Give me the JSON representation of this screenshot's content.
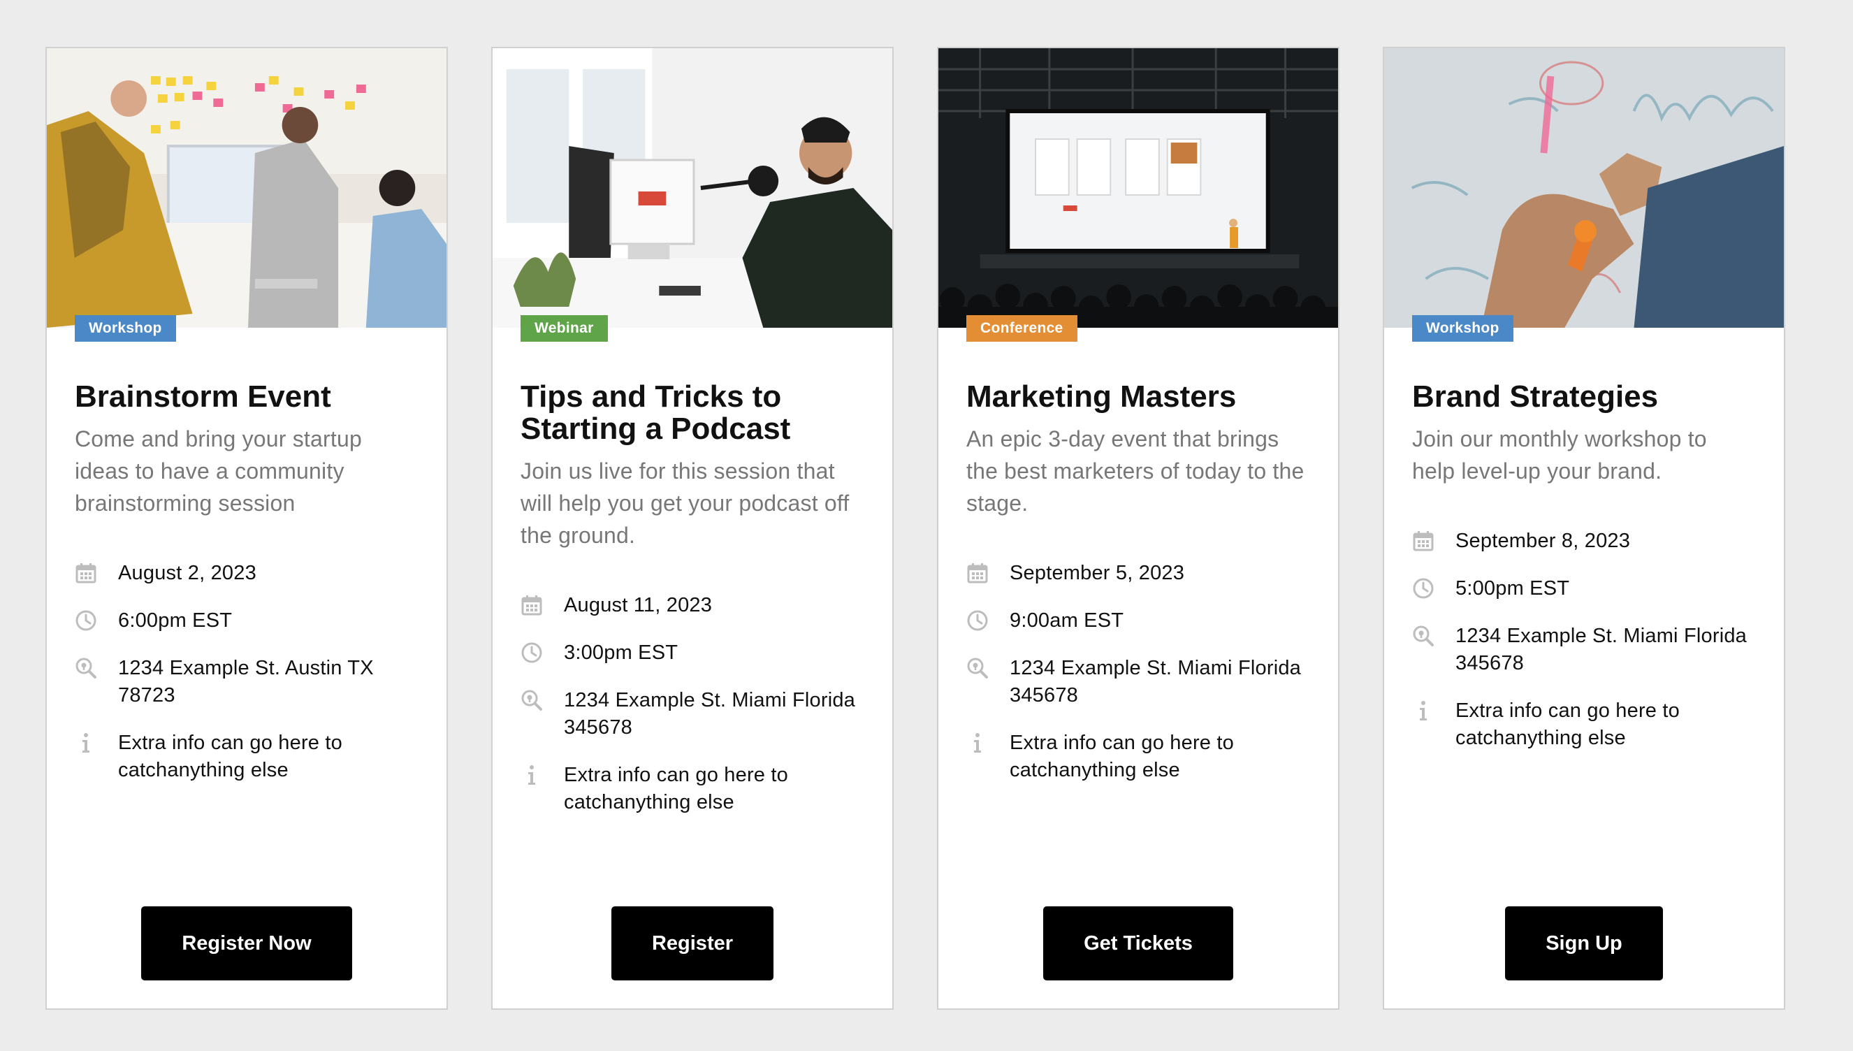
{
  "colors": {
    "workshop": "#4a88c8",
    "webinar": "#60a44a",
    "conference": "#e38e35",
    "button": "#000000",
    "icon": "#bdbdbd"
  },
  "cards": [
    {
      "badge": "Workshop",
      "badge_color": "#4a88c8",
      "title": "Brainstorm Event",
      "description": "Come and bring your startup ideas to have a community brainstorming session",
      "date": "August 2, 2023",
      "time": "6:00pm EST",
      "location": "1234 Example St. Austin TX 78723",
      "info": "Extra info can go here to catchanything else",
      "button": "Register Now",
      "icons": [
        "calendar-icon",
        "clock-icon",
        "location-search-icon",
        "info-icon"
      ]
    },
    {
      "badge": "Webinar",
      "badge_color": "#60a44a",
      "title": "Tips and Tricks to Starting a Podcast",
      "description": "Join us live for this session that will help you get your podcast off the ground.",
      "date": "August 11, 2023",
      "time": "3:00pm EST",
      "location": "1234 Example St. Miami Florida 345678",
      "info": "Extra info can go here to catchanything else",
      "button": "Register",
      "icons": [
        "calendar-icon",
        "clock-icon",
        "location-search-icon",
        "info-icon"
      ]
    },
    {
      "badge": "Conference",
      "badge_color": "#e38e35",
      "title": "Marketing Masters",
      "description": "An epic 3-day event that brings the best marketers of today to the stage.",
      "date": "September 5, 2023",
      "time": "9:00am EST",
      "location": "1234 Example St. Miami Florida 345678",
      "info": "Extra info can go here to catchanything else",
      "button": "Get Tickets",
      "icons": [
        "calendar-icon",
        "clock-icon",
        "location-search-icon",
        "info-icon"
      ]
    },
    {
      "badge": "Workshop",
      "badge_color": "#4a88c8",
      "title": "Brand Strategies",
      "description": "Join our monthly workshop to help level-up your brand.",
      "date": "September 8, 2023",
      "time": "5:00pm EST",
      "location": "1234 Example St. Miami Florida 345678",
      "info": "Extra info can go here to catchanything else",
      "button": "Sign Up",
      "icons": [
        "calendar-icon",
        "clock-icon",
        "location-search-icon",
        "info-icon"
      ]
    }
  ]
}
